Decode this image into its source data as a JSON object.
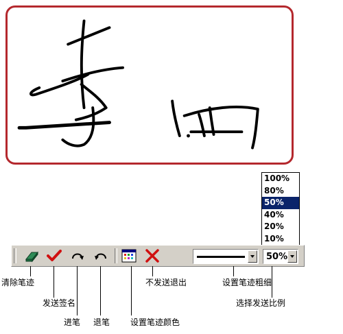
{
  "toolbar": {
    "tools": [
      {
        "name": "clear-strokes",
        "icon": "eraser-icon"
      },
      {
        "name": "send-signature",
        "icon": "checkmark-icon",
        "color": "#d01010"
      },
      {
        "name": "redo-stroke",
        "icon": "redo-arrow-icon"
      },
      {
        "name": "undo-stroke",
        "icon": "undo-arrow-icon"
      },
      {
        "name": "stroke-color",
        "icon": "color-palette-icon"
      },
      {
        "name": "exit-without-send",
        "icon": "close-x-icon",
        "color": "#d01010"
      }
    ],
    "stroke_width_select": {
      "icon": "line-thickness-icon"
    },
    "send_ratio_select": {
      "value": "50%"
    }
  },
  "ratio_dropdown": {
    "options": [
      "100%",
      "80%",
      "50%",
      "40%",
      "20%",
      "10%"
    ],
    "selected": "50%"
  },
  "captions": {
    "clear": "清除笔迹",
    "send": "发送签名",
    "redo": "进笔",
    "undo": "退笔",
    "color": "设置笔迹颜色",
    "exit": "不发送退出",
    "width": "设置笔迹粗细",
    "ratio": "选择发送比例"
  },
  "colors": {
    "canvas_border": "#b4282d",
    "toolbar_bg": "#d4d0c8",
    "selection": "#0a246a",
    "accent_red": "#d01010"
  }
}
